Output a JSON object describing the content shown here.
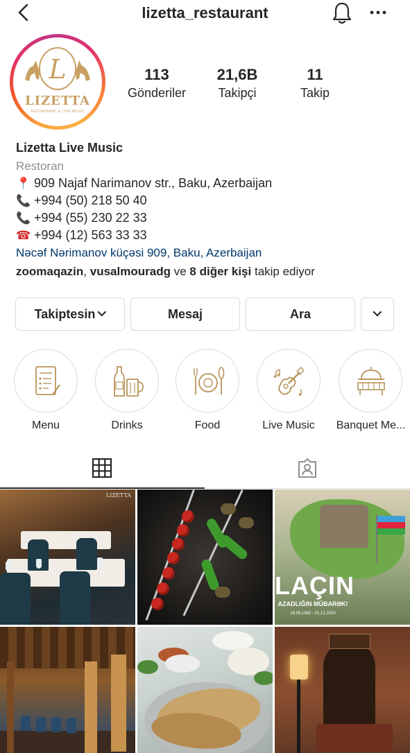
{
  "header": {
    "username": "lizetta_restaurant"
  },
  "profile": {
    "logo_text": "LIZETTA",
    "logo_subtext": "RESTAURANT & LIVE MUSIC",
    "stats": {
      "posts_value": "113",
      "posts_label": "Gönderiler",
      "followers_value": "21,6B",
      "followers_label": "Takipçi",
      "following_value": "11",
      "following_label": "Takip"
    }
  },
  "bio": {
    "name": "Lizetta Live Music",
    "category": "Restoran",
    "address": "909 Najaf Narimanov str., Baku, Azerbaijan",
    "phone_1": "+994 (50) 218 50 40",
    "phone_2": "+994 (55) 230 22 33",
    "phone_3": "+994 (12) 563 33 33",
    "address_link": "Nəcəf Nərimanov küçəsi 909, Baku, Azerbaijan",
    "followed_by_user_1": "zoomaqazin",
    "followed_by_sep": ",",
    "followed_by_user_2": "vusalmouradg",
    "followed_by_and": "ve",
    "followed_by_others": "8 diğer kişi",
    "followed_by_suffix": "takip ediyor"
  },
  "actions": {
    "following_label": "Takiptesin",
    "message_label": "Mesaj",
    "call_label": "Ara"
  },
  "highlights": [
    {
      "label": "Menu",
      "icon": "menu-icon"
    },
    {
      "label": "Drinks",
      "icon": "drinks-icon"
    },
    {
      "label": "Food",
      "icon": "food-icon"
    },
    {
      "label": "Live Music",
      "icon": "guitar-icon"
    },
    {
      "label": "Banquet Me...",
      "icon": "banquet-icon"
    }
  ],
  "tabs": [
    {
      "icon": "grid-icon",
      "active": true
    },
    {
      "icon": "tagged-icon",
      "active": false
    }
  ],
  "posts": [
    {
      "description": "restaurant-hall",
      "watermark": "LIZETTA"
    },
    {
      "description": "kebab-skewers"
    },
    {
      "description": "lachin-poster",
      "title": "LAÇIN",
      "subtitle": "AZADLIĞIN MÜBARƏK!",
      "date": "18.05.1992 - 01.12.2020"
    },
    {
      "description": "banquet-hall"
    },
    {
      "description": "qutab-plate"
    },
    {
      "description": "interior-lamp"
    }
  ],
  "colors": {
    "accent_link": "#00376b",
    "text_primary": "#262626",
    "text_secondary": "#8e8e8e",
    "border": "#dbdbdb",
    "logo_gold": "#c8a064"
  }
}
